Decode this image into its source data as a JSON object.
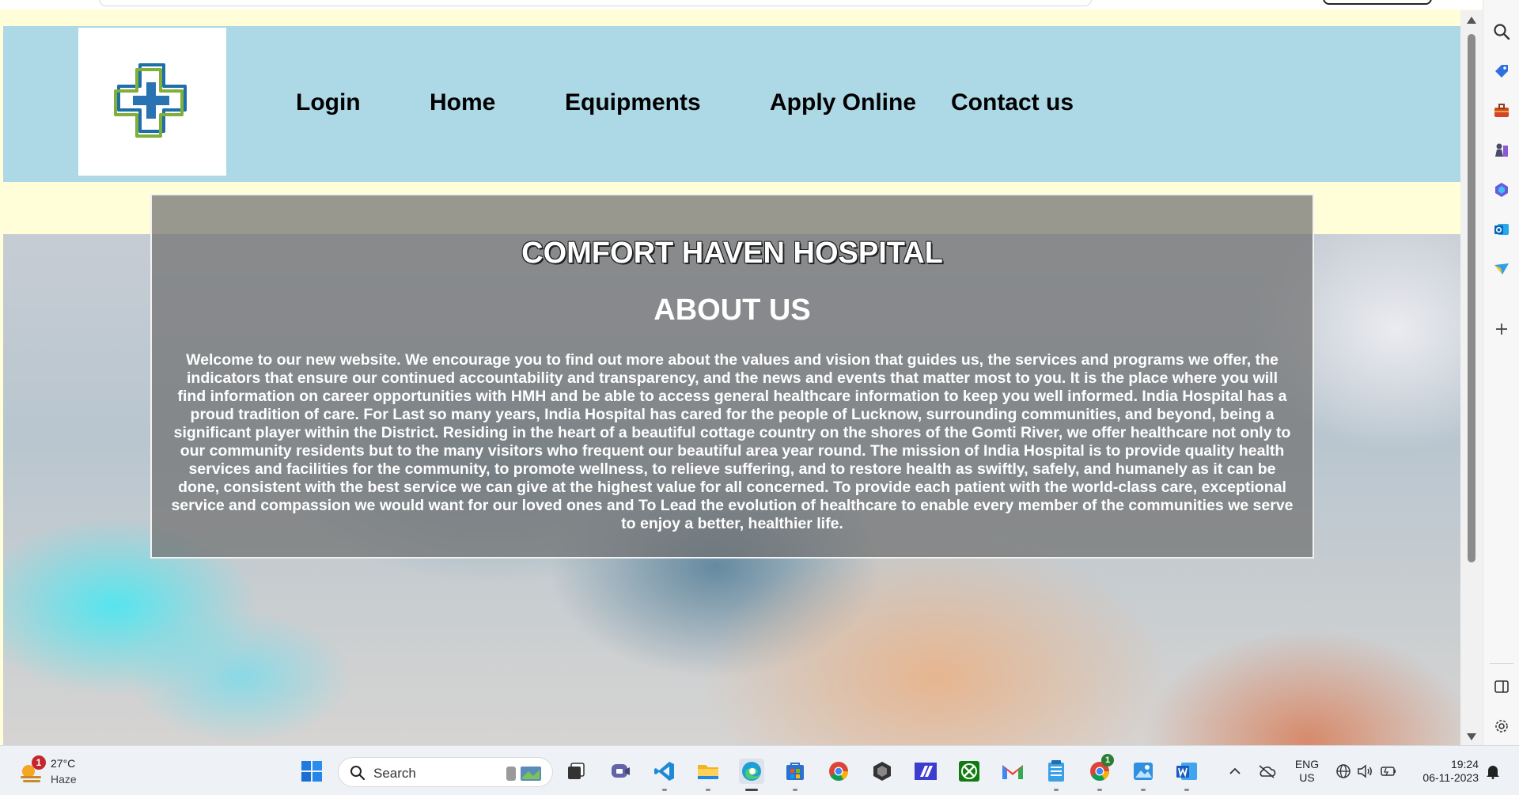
{
  "site": {
    "nav": [
      {
        "label": "Login"
      },
      {
        "label": "Home"
      },
      {
        "label": "Equipments"
      },
      {
        "label": "Apply Online"
      },
      {
        "label": "Contact us"
      }
    ],
    "hospital_name": "COMFORT HAVEN HOSPITAL",
    "about_heading": "ABOUT US",
    "about_text": "Welcome to our new website. We encourage you to find out more about the values and vision that guides us, the services and programs we offer, the indicators that ensure our continued accountability and transparency, and the news and events that matter most to you. It is the place where you will find information on career opportunities with HMH and be able to access general healthcare information to keep you well informed. India Hospital has a proud tradition of care. For Last so many years, India Hospital has cared for the people of Lucknow, surrounding communities, and beyond, being a significant player within the District. Residing in the heart of a beautiful cottage country on the shores of the Gomti River, we offer healthcare not only to our community residents but to the many visitors who frequent our beautiful area year round. The mission of India Hospital is to provide quality health services and facilities for the community, to promote wellness, to relieve suffering, and to restore health as swiftly, safely, and humanely as it can be done, consistent with the best service we can give at the highest value for all concerned. To provide each patient with the world-class care, exceptional service and compassion we would want for our loved ones and To Lead the evolution of healthcare to enable every member of the communities we serve to enjoy a better, healthier life.",
    "colors": {
      "header_bg": "#add8e6",
      "page_bg": "#fffed9",
      "card_overlay": "#707070"
    }
  },
  "taskbar": {
    "weather": {
      "temp": "27°C",
      "condition": "Haze",
      "badge": "1"
    },
    "search_label": "Search",
    "chrome_badge": "1",
    "language": {
      "line1": "ENG",
      "line2": "US"
    },
    "clock": {
      "time": "19:24",
      "date": "06-11-2023"
    },
    "apps": [
      "start-icon",
      "task-view-icon",
      "teams-icon",
      "vscode-icon",
      "file-explorer-icon",
      "edge-icon",
      "store-icon",
      "chrome-icon",
      "unity-icon",
      "power-automate-icon",
      "xbox-icon",
      "gmail-icon",
      "notepad-icon",
      "chrome-profile-icon",
      "photos-icon",
      "word-icon"
    ]
  },
  "sidebar_icons": [
    "search-icon",
    "tag-icon",
    "toolbox-icon",
    "chess-icon",
    "copilot-icon",
    "outlook-icon",
    "send-icon",
    "add-icon",
    "split-view-icon",
    "settings-icon"
  ]
}
